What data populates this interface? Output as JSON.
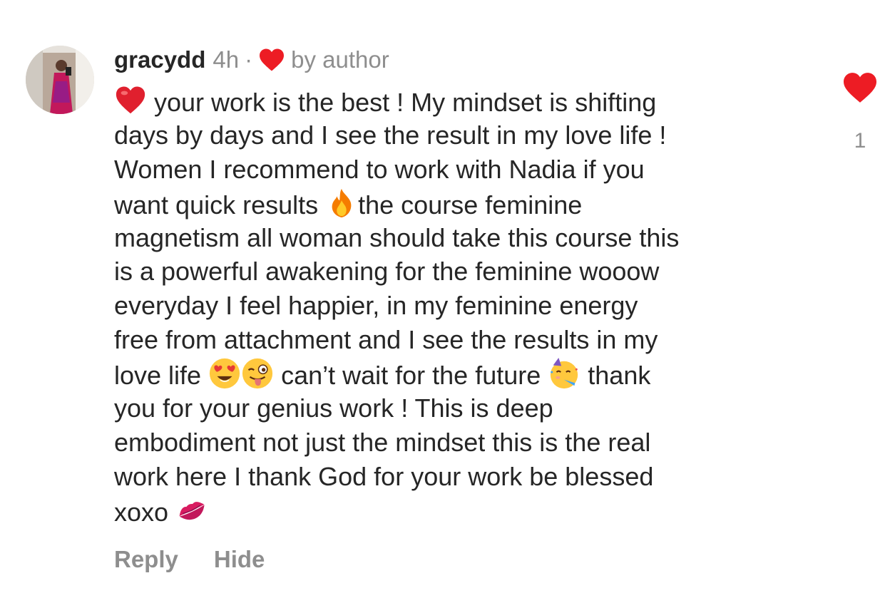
{
  "comment": {
    "username": "gracydd",
    "time": "4h",
    "separator": "·",
    "liked_by": "by author",
    "lines": [
      {
        "before": "",
        "emoji1": "heart-emoji",
        "after": " your work is the best ! My mindset is shifting"
      },
      {
        "text": "days by days and I see the result in my love life !"
      },
      {
        "text": "Women I recommend to work with Nadia if you"
      },
      {
        "before": "want quick results ",
        "emoji1": "fire-emoji",
        "after": "the course feminine"
      },
      {
        "text": "magnetism all woman should take this course this"
      },
      {
        "text": "is a powerful awakening for the feminine wooow"
      },
      {
        "text": "everyday I feel happier, in my feminine energy"
      },
      {
        "text": "free from attachment and I see the results in my"
      },
      {
        "before": "love life ",
        "emoji1": "heart-eyes-emoji",
        "emoji2": "winking-tongue-emoji",
        "middle": " can’t wait for the future ",
        "emoji3": "partying-face-emoji",
        "after": " thank"
      },
      {
        "text": "you for your genius work ! This is deep"
      },
      {
        "text": "embodiment not just the mindset this is the real"
      },
      {
        "text": "work here I thank God for your work be blessed"
      },
      {
        "before": "xoxo ",
        "emoji1": "kiss-mark-emoji",
        "after": ""
      }
    ]
  },
  "like": {
    "count": "1",
    "color": "#ed4956"
  },
  "actions": {
    "reply_label": "Reply",
    "hide_label": "Hide"
  }
}
